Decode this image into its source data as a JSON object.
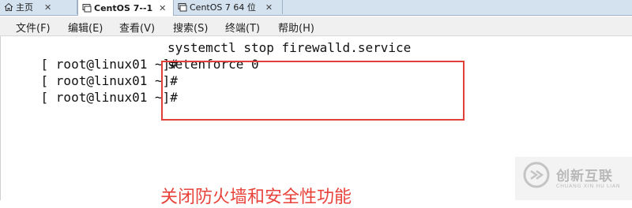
{
  "tabs": [
    {
      "label": "主页",
      "icon": "home-icon",
      "active": false
    },
    {
      "label": "CentOS 7--1",
      "icon": "vm-icon",
      "active": true
    },
    {
      "label": "CentOS 7 64 位",
      "icon": "vm-icon",
      "active": false
    }
  ],
  "menu": [
    {
      "label": "文件(F)"
    },
    {
      "label": "编辑(E)"
    },
    {
      "label": "查看(V)"
    },
    {
      "label": "搜索(S)"
    },
    {
      "label": "终端(T)"
    },
    {
      "label": "帮助(H)"
    }
  ],
  "terminal": {
    "lines": [
      {
        "prompt": "[ root@linux01 ~]#",
        "command": "systemctl stop firewalld.service"
      },
      {
        "prompt": "[ root@linux01 ~]#",
        "command": "setenforce 0"
      },
      {
        "prompt": "[ root@linux01 ~]#",
        "command": ""
      }
    ]
  },
  "annotation": "关闭防火墙和安全性功能",
  "watermark": {
    "name_cn": "创新互联",
    "name_en": "CHUANG XIN HU LIAN"
  },
  "colors": {
    "annotation": "#e8423a",
    "highlight_border": "#e0403a",
    "tabbar_bg": "#d4e1ef"
  }
}
